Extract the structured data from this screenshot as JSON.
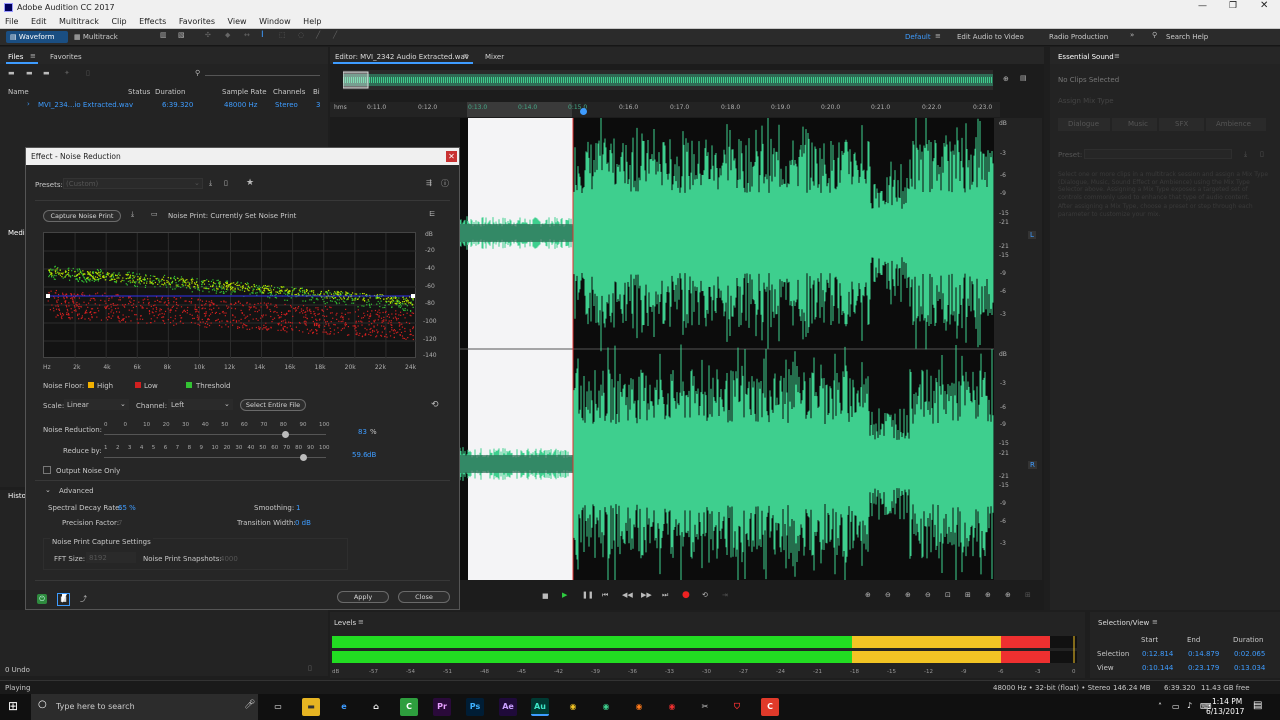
{
  "window": {
    "title": "Adobe Audition CC 2017"
  },
  "menu": [
    "File",
    "Edit",
    "Multitrack",
    "Clip",
    "Effects",
    "Favorites",
    "View",
    "Window",
    "Help"
  ],
  "toolbar": {
    "waveform": "Waveform",
    "multitrack": "Multitrack",
    "workspaces": [
      "Default",
      "Edit Audio to Video",
      "Radio Production"
    ],
    "search_placeholder": "Search Help"
  },
  "files_panel": {
    "tabs": [
      "Files",
      "Favorites"
    ],
    "columns": [
      "Name",
      "Status",
      "Duration",
      "Sample Rate",
      "Channels",
      "Bi"
    ],
    "rows": [
      {
        "name": "MVI_234...io Extracted.wav",
        "duration": "6:39.320",
        "sample_rate": "48000 Hz",
        "channels": "Stereo",
        "bits": "3"
      }
    ],
    "side_labels": [
      "Medi",
      "Histo"
    ]
  },
  "editor": {
    "tab": "Editor: MVI_2342 Audio Extracted.wav",
    "mixer": "Mixer",
    "ruler_unit": "hms",
    "ruler": [
      "0:11.0",
      "0:12.0",
      "0:13.0",
      "0:14.0",
      "0:15.0",
      "0:16.0",
      "0:17.0",
      "0:18.0",
      "0:19.0",
      "0:20.0",
      "0:21.0",
      "0:22.0",
      "0:23.0"
    ],
    "db_top": [
      "dB",
      "-3",
      "-6",
      "-9",
      "-15",
      "-21",
      "-21",
      "-15",
      "-9",
      "-6",
      "-3"
    ],
    "db_bottom": [
      "dB",
      "-3",
      "-6",
      "-9",
      "-15",
      "-21",
      "-21",
      "-15",
      "-9",
      "-6",
      "-3"
    ],
    "channel_left": "L",
    "channel_right": "R"
  },
  "effect": {
    "title": "Effect - Noise Reduction",
    "presets_label": "Presets:",
    "presets_value": "(Custom)",
    "capture_button": "Capture Noise Print",
    "noise_print_text": "Noise Print: Currently Set Noise Print",
    "graph_db": [
      "dB",
      "-20",
      "-40",
      "-60",
      "-80",
      "-100",
      "-120",
      "-140"
    ],
    "graph_freq": [
      "Hz",
      "2k",
      "4k",
      "6k",
      "8k",
      "10k",
      "12k",
      "14k",
      "16k",
      "18k",
      "20k",
      "22k",
      "24k"
    ],
    "legend_label": "Noise Floor:",
    "legend": [
      {
        "label": "High",
        "color": "#f2b000"
      },
      {
        "label": "Low",
        "color": "#d22020"
      },
      {
        "label": "Threshold",
        "color": "#33c233"
      }
    ],
    "scale_label": "Scale:",
    "scale_value": "Linear",
    "channel_label": "Channel:",
    "channel_value": "Left",
    "select_entire": "Select Entire File",
    "nr_label": "Noise Reduction:",
    "nr_ticks": [
      "0",
      "0",
      "10",
      "20",
      "30",
      "40",
      "50",
      "60",
      "70",
      "80",
      "90",
      "100"
    ],
    "nr_value": "83",
    "nr_unit": "%",
    "nr_fraction": 0.83,
    "rb_label": "Reduce by:",
    "rb_ticks": [
      "1",
      "2",
      "3",
      "4",
      "5",
      "6",
      "7",
      "8",
      "9",
      "10",
      "20",
      "30",
      "40",
      "50",
      "60",
      "70",
      "80",
      "90",
      "100"
    ],
    "rb_value": "59.6",
    "rb_unit": "dB",
    "rb_fraction": 0.91,
    "output_noise_only": "Output Noise Only",
    "advanced": "Advanced",
    "spectral_label": "Spectral Decay Rate:",
    "spectral_value": "65 %",
    "smoothing_label": "Smoothing:",
    "smoothing_value": "1",
    "precision_label": "Precision Factor:",
    "precision_value": "7",
    "transition_label": "Transition Width:",
    "transition_value": "0 dB",
    "capture_settings": "Noise Print Capture Settings",
    "fft_label": "FFT Size:",
    "fft_value": "8192",
    "snapshots_label": "Noise Print Snapshots:",
    "snapshots_value": "4000",
    "apply": "Apply",
    "close": "Close"
  },
  "essential_sound": {
    "title": "Essential Sound",
    "no_clips": "No Clips Selected",
    "assign": "Assign Mix Type",
    "types": [
      "Dialogue",
      "Music",
      "SFX",
      "Ambience"
    ],
    "preset": "Preset:",
    "desc1": "Select one or more clips in a multitrack session and assign a Mix Type (Dialogue, Music, Sound Effect or Ambience) using the Mix Type Selector above. Assigning a Mix Type exposes a targeted set of controls commonly used to enhance that type of audio content.",
    "desc2": "After assigning a Mix Type, choose a preset or step through each parameter to customize your mix."
  },
  "levels": {
    "title": "Levels",
    "scale": [
      "dB",
      "-57",
      "-54",
      "-51",
      "-48",
      "-45",
      "-42",
      "-39",
      "-36",
      "-33",
      "-30",
      "-27",
      "-24",
      "-21",
      "-18",
      "-15",
      "-12",
      "-9",
      "-6",
      "-3",
      "0"
    ]
  },
  "selection_view": {
    "title": "Selection/View",
    "headers": [
      "Start",
      "End",
      "Duration"
    ],
    "rows": [
      {
        "label": "Selection",
        "start": "0:12.814",
        "end": "0:14.879",
        "duration": "0:02.065"
      },
      {
        "label": "View",
        "start": "0:10.144",
        "end": "0:23.179",
        "duration": "0:13.034"
      }
    ]
  },
  "status": {
    "undo": "0 Undo",
    "playing": "Playing",
    "format": "48000 Hz • 32-bit (float) • Stereo",
    "size": "146.24 MB",
    "duration": "6:39.320",
    "free": "11.43 GB free"
  },
  "taskbar": {
    "search": "Type here to search",
    "time": "1:14 PM",
    "date": "6/13/2017"
  },
  "colors": {
    "accent": "#3e9cff",
    "waveform": "#3ecf8e",
    "wave_dim": "#2f6b55",
    "playhead": "#e03030",
    "meter_green": "#22dd22",
    "meter_yellow": "#f2c424",
    "meter_red": "#ee3030"
  }
}
